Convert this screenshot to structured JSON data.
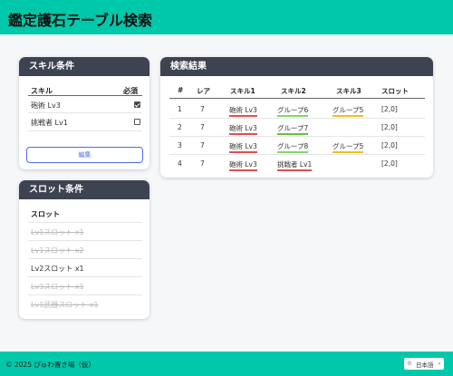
{
  "header": {
    "title": "鑑定護石テーブル検索"
  },
  "skill_card": {
    "title": "スキル条件",
    "col_skill": "スキル",
    "col_required": "必須",
    "items": [
      {
        "label": "砲術 Lv3",
        "required": true
      },
      {
        "label": "挑戦者 Lv1",
        "required": false
      }
    ],
    "edit_label": "編集"
  },
  "slot_card": {
    "title": "スロット条件",
    "col_slot": "スロット",
    "items": [
      {
        "label": "Lv1スロット x1",
        "enabled": false
      },
      {
        "label": "Lv1スロット x2",
        "enabled": false
      },
      {
        "label": "Lv2スロット x1",
        "enabled": true
      },
      {
        "label": "Lv3スロット x1",
        "enabled": false
      },
      {
        "label": "Lv1武器スロット x1",
        "enabled": false
      }
    ]
  },
  "results": {
    "title": "検索結果",
    "headers": [
      "#",
      "レア",
      "スキル1",
      "スキル2",
      "スキル3",
      "スロット"
    ],
    "rows": [
      {
        "no": "1",
        "rare": "7",
        "skill1": "砲術 Lv3",
        "skill2": "グループ6",
        "skill3": "グループ5",
        "slot": "[2,0]"
      },
      {
        "no": "2",
        "rare": "7",
        "skill1": "砲術 Lv3",
        "skill2": "グループ7",
        "skill3": "",
        "slot": "[2,0]"
      },
      {
        "no": "3",
        "rare": "7",
        "skill1": "砲術 Lv3",
        "skill2": "グループ8",
        "skill3": "グループ5",
        "slot": "[2,0]"
      },
      {
        "no": "4",
        "rare": "7",
        "skill1": "砲術 Lv3",
        "skill2": "挑戦者 Lv1",
        "skill3": "",
        "slot": "[2,0]"
      }
    ]
  },
  "footer": {
    "copyright": "© 2025 ぴゅわ置き場（仮）",
    "language": "日本語",
    "globe_icon": "globe-icon",
    "chevron_icon": "chevron-down-icon"
  },
  "colors": {
    "accent": "#00c8aa",
    "card_header": "#3d4351",
    "link_blue": "#4a6cf7",
    "underline_red": "#d9534f",
    "underline_green": "#6cbf3a"
  }
}
